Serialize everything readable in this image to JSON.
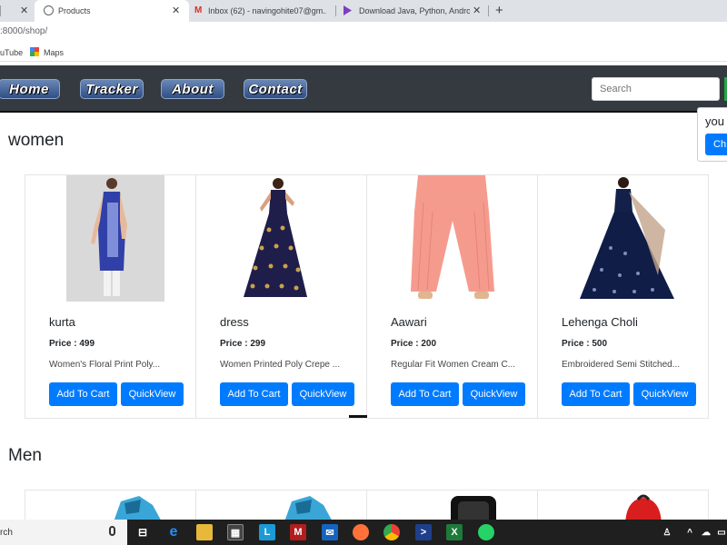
{
  "browser": {
    "tabs": [
      {
        "title": "Products"
      },
      {
        "title": "Inbox (62) - navingohite07@gm..."
      },
      {
        "title": "Download Java, Python, Android..."
      }
    ],
    "new_tab": "+",
    "close": "✕",
    "address": ":8000/shop/",
    "bookmarks": [
      {
        "label": "uTube"
      },
      {
        "label": "Maps"
      }
    ]
  },
  "nav": {
    "links": [
      "Home",
      "Tracker",
      "About",
      "Contact"
    ],
    "search_placeholder": "Search"
  },
  "popover": {
    "text": "you",
    "button": "Ch"
  },
  "sections": [
    {
      "title": "women",
      "products": [
        {
          "name": "kurta",
          "price": "Price : 499",
          "desc": "Women's Floral Print Poly...",
          "add": "Add To Cart",
          "quick": "QuickView"
        },
        {
          "name": "dress",
          "price": "Price : 299",
          "desc": "Women Printed Poly Crepe ...",
          "add": "Add To Cart",
          "quick": "QuickView"
        },
        {
          "name": "Aawari",
          "price": "Price : 200",
          "desc": "Regular Fit Women Cream C...",
          "add": "Add To Cart",
          "quick": "QuickView"
        },
        {
          "name": "Lehenga Choli",
          "price": "Price : 500",
          "desc": "Embroidered Semi Stitched...",
          "add": "Add To Cart",
          "quick": "QuickView"
        }
      ]
    },
    {
      "title": "Men",
      "products": []
    }
  ],
  "taskbar": {
    "search_text": "rch"
  },
  "colors": {
    "primary": "#007bff",
    "navbar": "#343a40"
  }
}
